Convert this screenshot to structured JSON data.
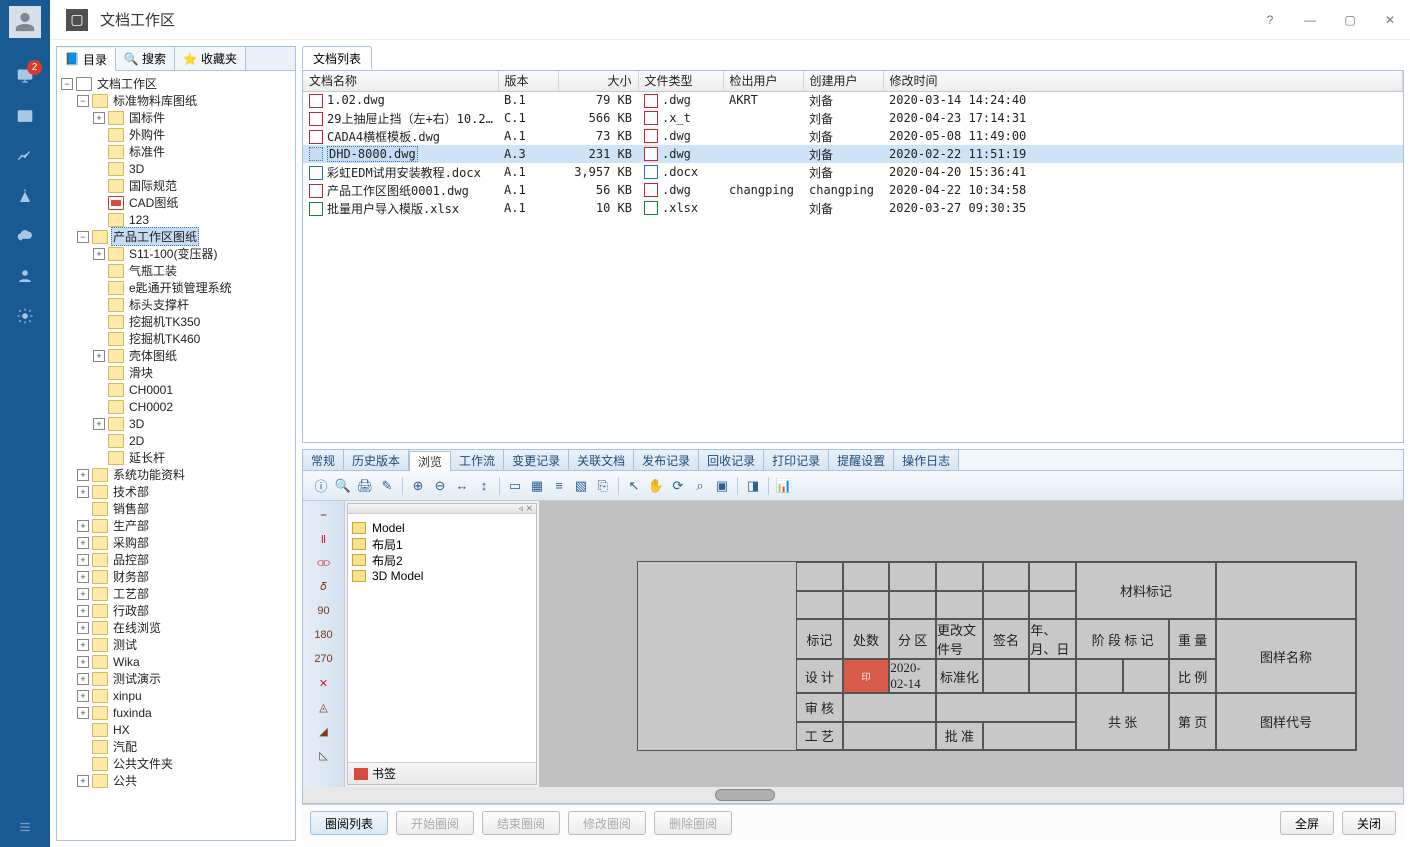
{
  "titlebar": {
    "title": "文档工作区",
    "badge": "2"
  },
  "left_tabs": {
    "catalog": "目录",
    "search": "搜索",
    "favorites": "收藏夹"
  },
  "tree": {
    "root": "文档工作区",
    "n_stdlib": "标准物料库图纸",
    "n_gb": "国标件",
    "n_wg": "外购件",
    "n_bz": "标准件",
    "n_3d": "3D",
    "n_intl": "国际规范",
    "n_cad": "CAD图纸",
    "n_123": "123",
    "n_prod": "产品工作区图纸",
    "n_s11": "S11-100(变压器)",
    "n_qp": "气瓶工装",
    "n_ekey": "e匙通开锁管理系统",
    "n_btz": "标头支撑杆",
    "n_wjk350": "挖掘机TK350",
    "n_wjk460": "挖掘机TK460",
    "n_kt": "壳体图纸",
    "n_hk": "滑块",
    "n_ch1": "CH0001",
    "n_ch2": "CH0002",
    "n_3d2": "3D",
    "n_2d": "2D",
    "n_ycg": "延长杆",
    "n_sys": "系统功能资料",
    "n_tech": "技术部",
    "n_sales": "销售部",
    "n_prodd": "生产部",
    "n_cg": "采购部",
    "n_pk": "品控部",
    "n_cw": "财务部",
    "n_gy": "工艺部",
    "n_xz": "行政部",
    "n_zx": "在线浏览",
    "n_test": "测试",
    "n_wika": "Wika",
    "n_csys": "测试演示",
    "n_xinpu": "xinpu",
    "n_fux": "fuxinda",
    "n_hx": "HX",
    "n_qip": "汽配",
    "n_ggwjj": "公共文件夹",
    "n_gg": "公共"
  },
  "rp_tab": "文档列表",
  "columns": {
    "name": "文档名称",
    "version": "版本",
    "size": "大小",
    "type": "文件类型",
    "checkout": "检出用户",
    "creator": "创建用户",
    "modified": "修改时间"
  },
  "rows": [
    {
      "name": "1.02.dwg",
      "ver": "B.1",
      "size": "79 KB",
      "type": ".dwg",
      "co": "AKRT",
      "creator": "刘备",
      "mod": "2020-03-14 14:24:40",
      "ic": "dwg"
    },
    {
      "name": "29上抽屉止挡（左+右）10.2…",
      "ver": "C.1",
      "size": "566 KB",
      "type": ".x_t",
      "co": "",
      "creator": "刘备",
      "mod": "2020-04-23 17:14:31",
      "ic": "dwg"
    },
    {
      "name": "CADA4横框模板.dwg",
      "ver": "A.1",
      "size": "73 KB",
      "type": ".dwg",
      "co": "",
      "creator": "刘备",
      "mod": "2020-05-08 11:49:00",
      "ic": "dwg"
    },
    {
      "name": "DHD-8000.dwg",
      "ver": "A.3",
      "size": "231 KB",
      "type": ".dwg",
      "co": "",
      "creator": "刘备",
      "mod": "2020-02-22 11:51:19",
      "ic": "dwg"
    },
    {
      "name": "彩虹EDM试用安装教程.docx",
      "ver": "A.1",
      "size": "3,957 KB",
      "type": ".docx",
      "co": "",
      "creator": "刘备",
      "mod": "2020-04-20 15:36:41",
      "ic": "docx"
    },
    {
      "name": "产品工作区图纸0001.dwg",
      "ver": "A.1",
      "size": "56 KB",
      "type": ".dwg",
      "co": "changping",
      "creator": "changping",
      "mod": "2020-04-22 10:34:58",
      "ic": "dwg"
    },
    {
      "name": "批量用户导入模版.xlsx",
      "ver": "A.1",
      "size": "10 KB",
      "type": ".xlsx",
      "co": "",
      "creator": "刘备",
      "mod": "2020-03-27 09:30:35",
      "ic": "xlsx"
    }
  ],
  "tabs2": [
    "常规",
    "历史版本",
    "浏览",
    "工作流",
    "变更记录",
    "关联文档",
    "发布记录",
    "回收记录",
    "打印记录",
    "提醒设置",
    "操作日志"
  ],
  "layers": {
    "items": [
      "Model",
      "布局1",
      "布局2",
      "3D Model"
    ],
    "bookmark": "书签"
  },
  "drawing": {
    "material": "材料标记",
    "title": "图样名称",
    "code": "图样代号",
    "h_bj": "标记",
    "h_cs": "处数",
    "h_fq": "分  区",
    "h_gg": "更改文件号",
    "h_qm": "签名",
    "h_nyr": "年、月、日",
    "r_sj": "设  计",
    "r_date": "2020-02-14",
    "r_bzh": "标准化",
    "r_sh": "审  核",
    "r_gy": "工  艺",
    "r_pz": "批  准",
    "jd": "阶 段 标 记",
    "zz": "重  量",
    "bl": "比  例",
    "gz": "共     张",
    "dy": "第     页"
  },
  "footer": {
    "list": "圈阅列表",
    "start": "开始圈阅",
    "end": "结束圈阅",
    "edit": "修改圈阅",
    "del": "删除圈阅",
    "full": "全屏",
    "close": "关闭"
  }
}
